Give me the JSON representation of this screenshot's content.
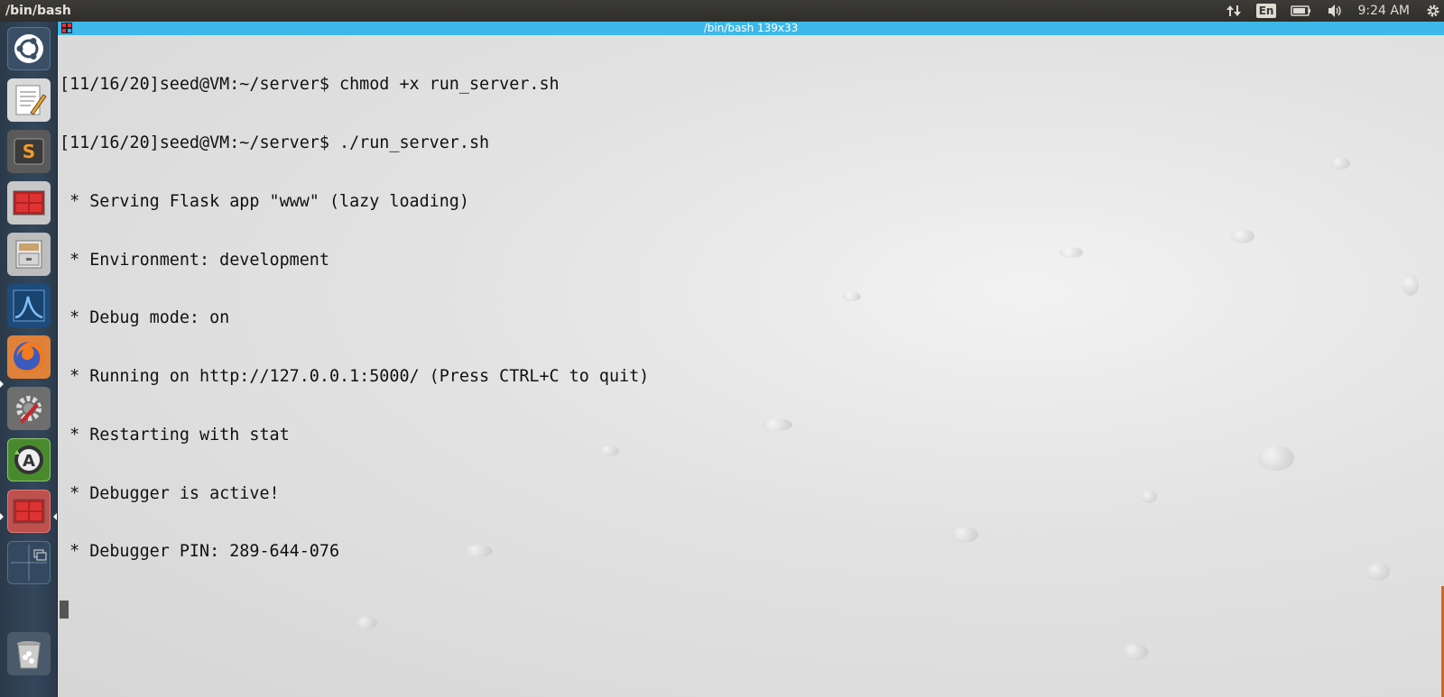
{
  "top_panel": {
    "window_title": "/bin/bash",
    "tray": {
      "network_icon": "network-updown-icon",
      "keyboard_layout": "En",
      "battery_icon": "battery-icon",
      "volume_icon": "volume-icon",
      "clock": "9:24 AM",
      "settings_icon": "gear-icon"
    }
  },
  "launcher": {
    "items": [
      {
        "name": "ubuntu-dash",
        "icon": "ubuntu-logo-icon"
      },
      {
        "name": "text-editor",
        "icon": "text-editor-icon"
      },
      {
        "name": "sublime-text",
        "icon": "sublime-text-icon"
      },
      {
        "name": "terminal",
        "icon": "terminal-icon"
      },
      {
        "name": "file-manager",
        "icon": "file-cabinet-icon"
      },
      {
        "name": "wireshark",
        "icon": "wireshark-fin-icon"
      },
      {
        "name": "firefox",
        "icon": "firefox-icon"
      },
      {
        "name": "system-settings",
        "icon": "settings-wrench-icon"
      },
      {
        "name": "software-updater",
        "icon": "software-updater-icon"
      },
      {
        "name": "terminal-active",
        "icon": "terminal-icon"
      },
      {
        "name": "workspace-switcher",
        "icon": "workspace-switcher-icon"
      },
      {
        "name": "trash",
        "icon": "trash-icon"
      }
    ]
  },
  "terminal": {
    "title": "/bin/bash 139x33",
    "lines": [
      "[11/16/20]seed@VM:~/server$ chmod +x run_server.sh",
      "[11/16/20]seed@VM:~/server$ ./run_server.sh",
      " * Serving Flask app \"www\" (lazy loading)",
      " * Environment: development",
      " * Debug mode: on",
      " * Running on http://127.0.0.1:5000/ (Press CTRL+C to quit)",
      " * Restarting with stat",
      " * Debugger is active!",
      " * Debugger PIN: 289-644-076"
    ]
  }
}
